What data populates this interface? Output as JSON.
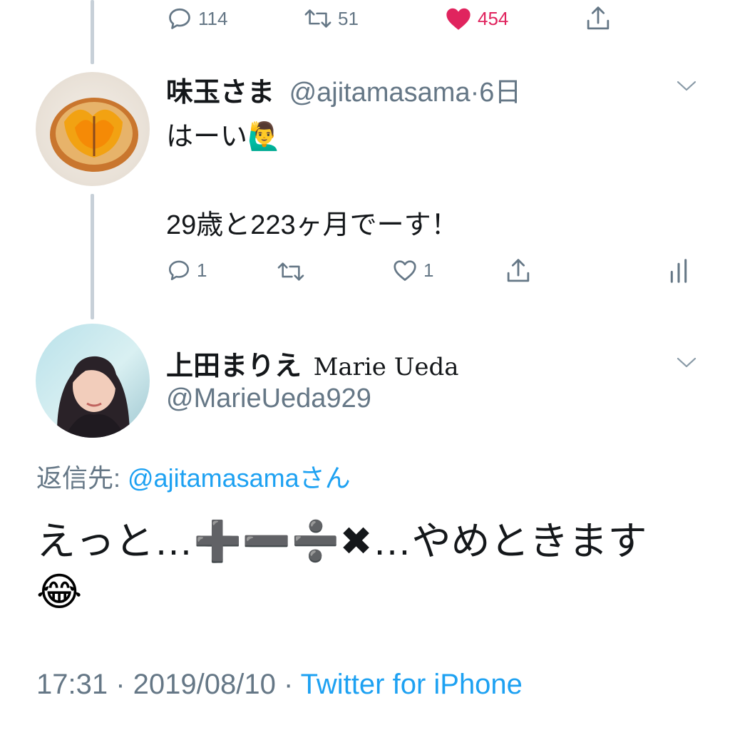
{
  "top_actions": {
    "reply_count": "114",
    "retweet_count": "51",
    "like_count": "454"
  },
  "tweet1": {
    "display_name": "味玉さま",
    "handle": "@ajitamasama",
    "sep": "·",
    "time": "6日",
    "line1": "はーい🙋‍♂️",
    "line2": "29歳と223ヶ月でーす！",
    "reply_count": "1",
    "like_count": "1"
  },
  "tweet2": {
    "display_name": "上田まりえ",
    "display_name_latin": "Marie Ueda",
    "handle": "@MarieUeda929",
    "reply_prefix": "返信先: ",
    "reply_to": "@ajitamasamaさん",
    "body_line1": "えっと…➕➖➗✖…やめときます",
    "body_line2": "😂",
    "timestamp": "17:31 · 2019/08/10 · ",
    "source": "Twitter for iPhone"
  },
  "colors": {
    "accent": "#1da1f2",
    "like": "#e0245e",
    "muted": "#657786",
    "text": "#14171a",
    "thread": "#c7d0d8"
  },
  "icons": [
    "reply-icon",
    "retweet-icon",
    "heart-icon",
    "share-icon",
    "analytics-icon",
    "chevron-down-icon"
  ]
}
